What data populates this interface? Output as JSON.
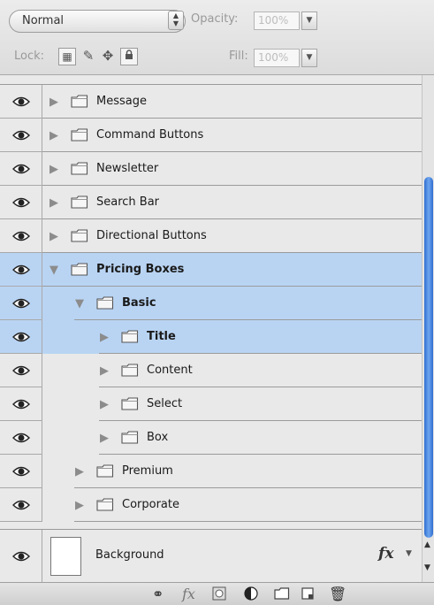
{
  "top": {
    "blend_mode": "Normal",
    "opacity_label": "Opacity:",
    "opacity_value": "100%",
    "lock_label": "Lock:",
    "fill_label": "Fill:",
    "fill_value": "100%",
    "lock_icons": [
      "lock-transparent-icon",
      "lock-image-icon",
      "lock-position-icon",
      "lock-all-icon"
    ]
  },
  "layers": [
    {
      "name": "Message",
      "indent": 0,
      "expanded": false,
      "selected": false,
      "bold": false
    },
    {
      "name": "Command Buttons",
      "indent": 0,
      "expanded": false,
      "selected": false,
      "bold": false
    },
    {
      "name": "Newsletter",
      "indent": 0,
      "expanded": false,
      "selected": false,
      "bold": false
    },
    {
      "name": "Search Bar",
      "indent": 0,
      "expanded": false,
      "selected": false,
      "bold": false
    },
    {
      "name": "Directional Buttons",
      "indent": 0,
      "expanded": false,
      "selected": false,
      "bold": false
    },
    {
      "name": "Pricing Boxes",
      "indent": 0,
      "expanded": true,
      "selected": true,
      "bold": true
    },
    {
      "name": "Basic",
      "indent": 1,
      "expanded": true,
      "selected": true,
      "bold": true
    },
    {
      "name": "Title",
      "indent": 2,
      "expanded": false,
      "selected": true,
      "bold": true
    },
    {
      "name": "Content",
      "indent": 2,
      "expanded": false,
      "selected": false,
      "bold": false
    },
    {
      "name": "Select",
      "indent": 2,
      "expanded": false,
      "selected": false,
      "bold": false
    },
    {
      "name": "Box",
      "indent": 2,
      "expanded": false,
      "selected": false,
      "bold": false
    },
    {
      "name": "Premium",
      "indent": 1,
      "expanded": false,
      "selected": false,
      "bold": false
    },
    {
      "name": "Corporate",
      "indent": 1,
      "expanded": false,
      "selected": false,
      "bold": false
    }
  ],
  "background_layer": {
    "name": "Background",
    "fx": "fx"
  },
  "bottom_icons": [
    "link-layers-icon",
    "fx-icon",
    "mask-icon",
    "adjustment-icon",
    "new-group-icon",
    "new-layer-icon",
    "trash-icon"
  ],
  "colors": {
    "selection": "#b9d4f3",
    "scroll_thumb": "#3f7ee0"
  }
}
